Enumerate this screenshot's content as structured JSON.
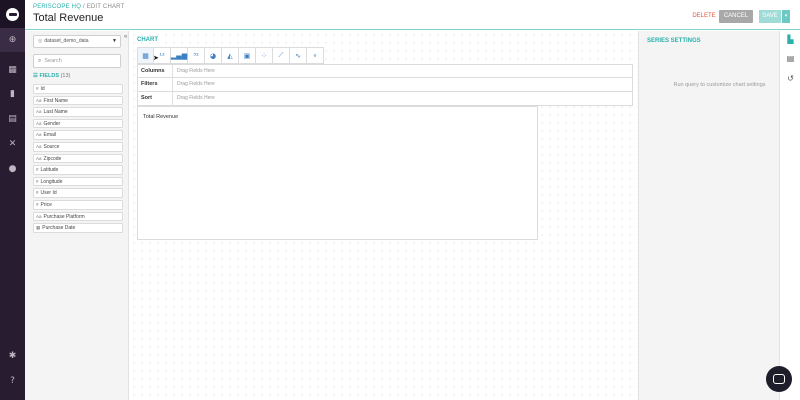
{
  "header": {
    "breadcrumb_root": "PERISCOPE HQ",
    "breadcrumb_sep": " / ",
    "breadcrumb_current": "EDIT CHART",
    "title": "Total Revenue",
    "delete_label": "DELETE",
    "cancel_label": "CANCEL",
    "save_label": "SAVE",
    "save_dropdown_icon": "chevron-down-icon"
  },
  "nav": {
    "logo": "periscope-logo",
    "icons": [
      "globe-icon",
      "dashboard-icon",
      "bookmark-icon",
      "document-icon",
      "tools-icon",
      "bell-icon",
      "settings-icon",
      "help-icon"
    ]
  },
  "dataset": {
    "value": "dataset_demo_data"
  },
  "search": {
    "placeholder": "Search"
  },
  "fields": {
    "heading": "FIELDS",
    "count": "(13)",
    "items": [
      {
        "type": "#",
        "name": "Id"
      },
      {
        "type": "Aa",
        "name": "First Name"
      },
      {
        "type": "Aa",
        "name": "Last Name"
      },
      {
        "type": "Aa",
        "name": "Gender"
      },
      {
        "type": "Aa",
        "name": "Email"
      },
      {
        "type": "Aa",
        "name": "Source"
      },
      {
        "type": "Aa",
        "name": "Zipcode"
      },
      {
        "type": "#",
        "name": "Latitude"
      },
      {
        "type": "#",
        "name": "Longitude"
      },
      {
        "type": "#",
        "name": "User Id"
      },
      {
        "type": "#",
        "name": "Price"
      },
      {
        "type": "Aa",
        "name": "Purchase Platform"
      },
      {
        "type": "▦",
        "name": "Purchase Date"
      }
    ]
  },
  "chart": {
    "section_label": "CHART",
    "types": [
      "table-icon",
      "number-icon",
      "bar-chart-icon",
      "scalar-icon",
      "pie-chart-icon",
      "area-chart-icon",
      "image-icon",
      "scatter-icon",
      "line-icon",
      "bubble-icon",
      "map-icon"
    ],
    "shelves": [
      {
        "label": "Columns",
        "placeholder": "Drag Fields Here"
      },
      {
        "label": "Filters",
        "placeholder": "Drag Fields Here"
      },
      {
        "label": "Sort",
        "placeholder": "Drag Fields Here"
      }
    ],
    "result_header": "Total Revenue"
  },
  "series": {
    "title": "SERIES SETTINGS",
    "message": "Run query to customize chart settings"
  },
  "rail": {
    "icons": [
      "chart-settings-icon",
      "notes-icon",
      "history-icon"
    ]
  }
}
